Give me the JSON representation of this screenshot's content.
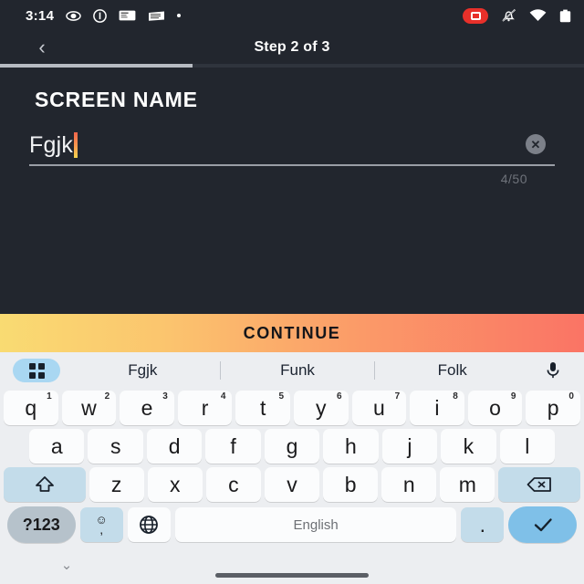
{
  "status_bar": {
    "time": "3:14",
    "left_icons": [
      "eye-icon",
      "info-circle-icon",
      "ticket-icon",
      "receipt-icon",
      "dot-icon"
    ],
    "right_icons": [
      "screen-record-icon",
      "notifications-off-icon",
      "wifi-icon",
      "battery-icon"
    ]
  },
  "header": {
    "back_label": "‹",
    "title": "Step 2 of 3",
    "progress_percent": 33
  },
  "form": {
    "section_title": "SCREEN NAME",
    "input_value": "Fgjk",
    "clear_label": "✕",
    "char_count": "4/50"
  },
  "cta": {
    "continue_label": "CONTINUE",
    "gradient_start": "#F9DB72",
    "gradient_end": "#FA7465"
  },
  "keyboard": {
    "suggestions": [
      "Fgjk",
      "Funk",
      "Folk"
    ],
    "row1": [
      {
        "key": "q",
        "sup": "1"
      },
      {
        "key": "w",
        "sup": "2"
      },
      {
        "key": "e",
        "sup": "3"
      },
      {
        "key": "r",
        "sup": "4"
      },
      {
        "key": "t",
        "sup": "5"
      },
      {
        "key": "y",
        "sup": "6"
      },
      {
        "key": "u",
        "sup": "7"
      },
      {
        "key": "i",
        "sup": "8"
      },
      {
        "key": "o",
        "sup": "9"
      },
      {
        "key": "p",
        "sup": "0"
      }
    ],
    "row2": [
      "a",
      "s",
      "d",
      "f",
      "g",
      "h",
      "j",
      "k",
      "l"
    ],
    "row3": [
      "z",
      "x",
      "c",
      "v",
      "b",
      "n",
      "m"
    ],
    "shift_label": "⇧",
    "backspace_label": "⌫",
    "symbols_label": "?123",
    "emoji_label": "☺",
    "comma_label": ",",
    "globe_label": "⊕",
    "space_label": "English",
    "period_label": ".",
    "enter_label": "✓",
    "accent_key_color": "#C3DCEA",
    "enter_key_color": "#7FC0E8"
  },
  "nav": {
    "hide_keyboard_label": "⌄"
  }
}
